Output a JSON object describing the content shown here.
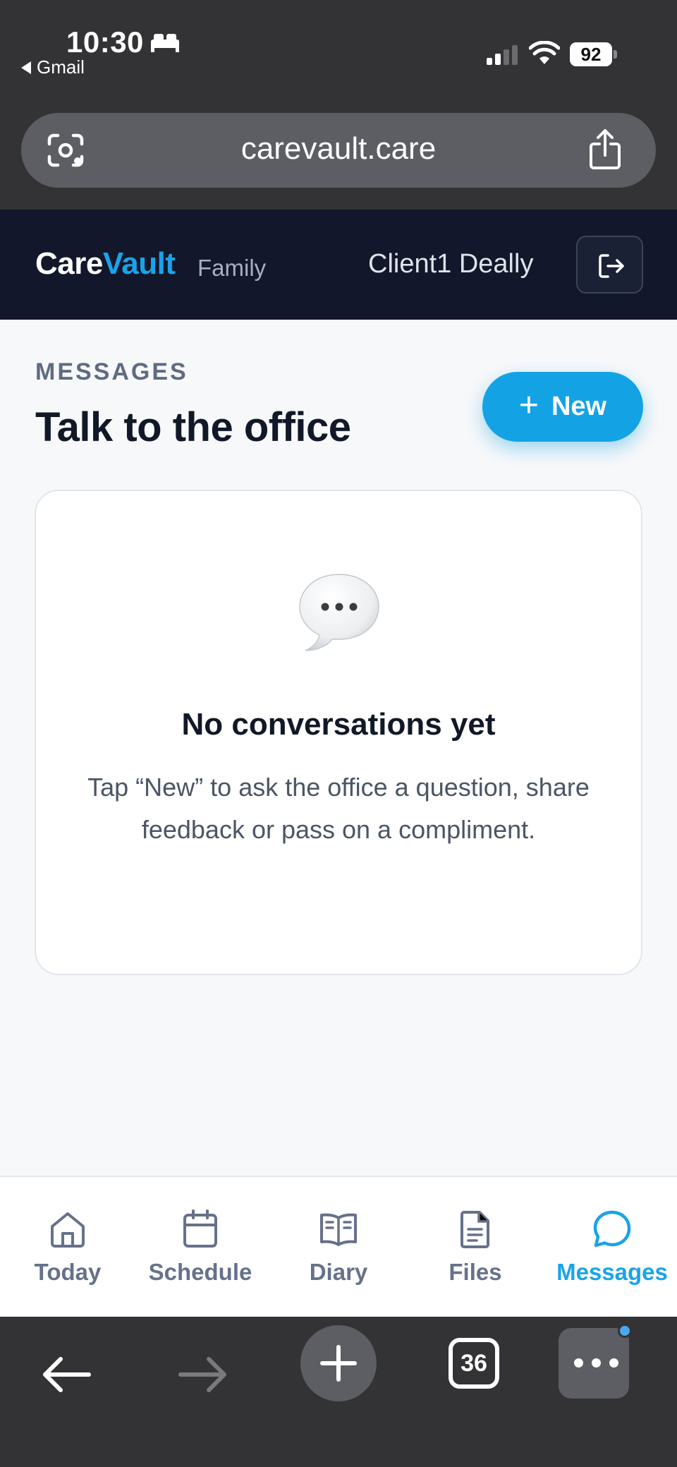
{
  "status_bar": {
    "time": "10:30",
    "back_app": "Gmail",
    "battery": "92",
    "icons": [
      "bed-icon",
      "signal-icon",
      "wifi-icon",
      "battery-icon"
    ]
  },
  "browser": {
    "url": "carevault.care",
    "icons": [
      "lens-icon",
      "share-icon"
    ]
  },
  "header": {
    "brand_care": "Care",
    "brand_vault": "Vault",
    "brand_sub": "Family",
    "client_name": "Client1 Deally",
    "logout_icon": "logout-icon"
  },
  "main": {
    "section_label": "MESSAGES",
    "title": "Talk to the office",
    "new_button": {
      "icon": "+",
      "label": "New"
    }
  },
  "empty_state": {
    "icon": "speech-bubble-icon",
    "title": "No conversations yet",
    "description": "Tap “New” to ask the office a question, share feedback or pass on a compliment."
  },
  "tabbar": {
    "items": [
      {
        "label": "Today",
        "icon": "home-icon",
        "active": false
      },
      {
        "label": "Schedule",
        "icon": "calendar-icon",
        "active": false
      },
      {
        "label": "Diary",
        "icon": "book-icon",
        "active": false
      },
      {
        "label": "Files",
        "icon": "file-icon",
        "active": false
      },
      {
        "label": "Messages",
        "icon": "chat-icon",
        "active": true
      }
    ]
  },
  "browser_toolbar": {
    "tab_count": "36",
    "icons": [
      "back-arrow-icon",
      "forward-arrow-icon",
      "plus-icon",
      "tabs-icon",
      "more-icon"
    ]
  },
  "colors": {
    "accent": "#13a3e4",
    "header_bg": "#12172b",
    "page_bg": "#f7f8fa",
    "browser_chrome": "#333335"
  }
}
